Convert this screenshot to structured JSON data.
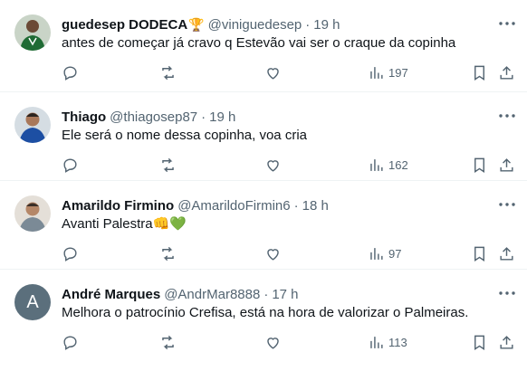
{
  "tweets": [
    {
      "name": "guedesep DODECA",
      "name_emoji": "🏆",
      "handle": "@viniguedesep",
      "time": "19 h",
      "text": "antes de começar já cravo q Estevão vai ser o craque da copinha",
      "views": "197",
      "avatar": "green-jersey-photo"
    },
    {
      "name": "Thiago",
      "handle": "@thiagosep87",
      "time": "19 h",
      "text": "Ele será o nome dessa copinha, voa cria",
      "views": "162",
      "avatar": "man-blue-shirt-photo"
    },
    {
      "name": "Amarildo Firmino",
      "handle": "@AmarildoFirmin6",
      "time": "18 h",
      "text": "Avanti Palestra",
      "text_emoji": "👊💚",
      "views": "97",
      "avatar": "man-photo"
    },
    {
      "name": "André Marques",
      "handle": "@AndrMar8888",
      "time": "17 h",
      "text": "Melhora o patrocínio Crefisa, está na hora de valorizar o Palmeiras.",
      "views": "113",
      "avatar_letter": "A"
    }
  ],
  "separator": "·"
}
